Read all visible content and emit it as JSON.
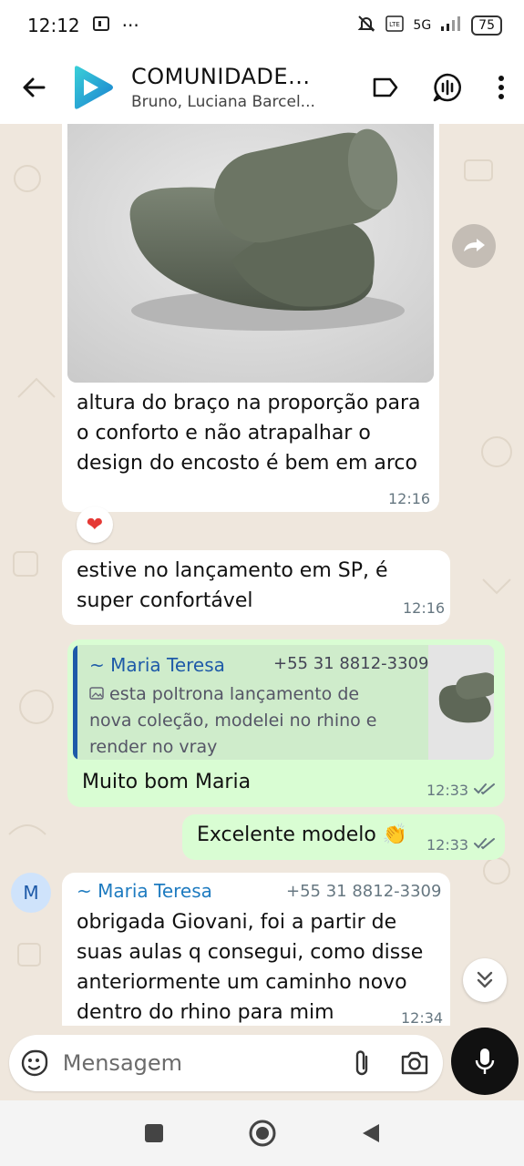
{
  "status_bar": {
    "time": "12:12",
    "extra": "···",
    "network": "5G",
    "battery": "75"
  },
  "header": {
    "title": "COMUNIDADE...",
    "members": "Bruno, Luciana Barcel..."
  },
  "messages": {
    "m1": {
      "text_line1": "altura do braço na proporção para",
      "text_line2": "o conforto e não atrapalhar o",
      "text_line3": "design do encosto é bem em arco",
      "time": "12:16",
      "reaction": "❤"
    },
    "m2": {
      "text_line1": "estive no lançamento em SP, é",
      "text_line2": "super confortável",
      "time": "12:16"
    },
    "m3": {
      "quote_sender": "~ Maria Teresa",
      "quote_phone": "+55 31 8812-3309",
      "quote_line1": "esta poltrona lançamento de",
      "quote_line2": "nova coleção, modelei no rhino e",
      "quote_line3": "render no vray",
      "text": "Muito bom Maria",
      "time": "12:33"
    },
    "m4": {
      "text": "Excelente modelo",
      "emoji": "👏",
      "time": "12:33"
    },
    "m5": {
      "avatar_letter": "M",
      "sender": "~ Maria Teresa",
      "phone": "+55 31 8812-3309",
      "text_line1": "obrigada Giovani, foi a partir de",
      "text_line2": "suas aulas q consegui, como disse",
      "text_line3": "anteriormente um caminho novo",
      "text_line4": "dentro do rhino para mim",
      "time": "12:34"
    }
  },
  "composer": {
    "placeholder": "Mensagem"
  },
  "colors": {
    "outgoing_bubble": "#d9fdd3",
    "incoming_bubble": "#ffffff",
    "chat_background": "#efe7dd",
    "quote_accent": "#1e5aa8",
    "sender_name": "#1e7bc0"
  }
}
